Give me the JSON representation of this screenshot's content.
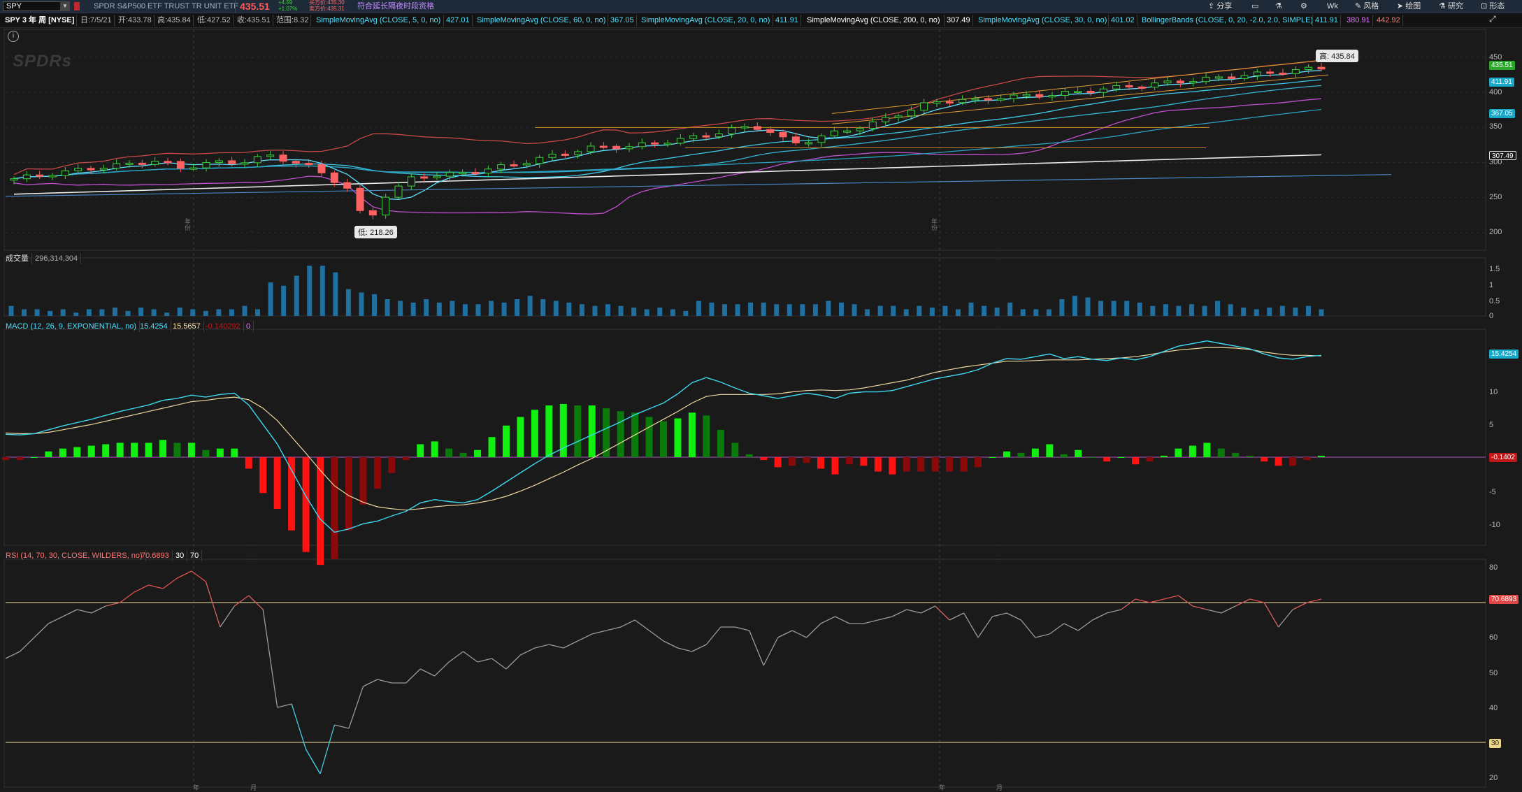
{
  "topbar": {
    "symbol": "SPY",
    "description": "SPDR S&P500 ETF TRUST TR UNIT ETF",
    "last": "435.51",
    "change_abs": "+4.59",
    "change_pct": "+1.07%",
    "bid": "买方价:435.30",
    "ask": "卖方价:435.31",
    "extended_hours": "符合延长隔夜时段资格",
    "buttons": {
      "share": "分享",
      "timeframe": "Wk",
      "style": "风格",
      "draw": "绘图",
      "study": "研究",
      "patterns": "形态"
    }
  },
  "infobar": {
    "title": "SPY 3 年 周 [NYSE]",
    "date": "日:7/5/21",
    "open": "开:433.78",
    "high": "高:435.84",
    "low": "低:427.52",
    "close": "收:435.51",
    "range": "范围:8.32",
    "studies": [
      {
        "label": "SimpleMovingAvg (CLOSE, 5, 0, no)",
        "value": "427.01",
        "color": "#4fe0ff"
      },
      {
        "label": "SimpleMovingAvg (CLOSE, 60, 0, no)",
        "value": "367.05",
        "color": "#4fe0ff"
      },
      {
        "label": "SimpleMovingAvg (CLOSE, 20, 0, no)",
        "value": "411.91",
        "color": "#4fe0ff"
      },
      {
        "label": "SimpleMovingAvg (CLOSE, 200, 0, no)",
        "value": "307.49",
        "color": "#ffffff"
      },
      {
        "label": "SimpleMovingAvg (CLOSE, 30, 0, no)",
        "value": "401.02",
        "color": "#4fe0ff"
      },
      {
        "label": "BollingerBands (CLOSE, 0, 20, -2.0, 2.0, SIMPLE)",
        "value": "411.91",
        "color": "#4fe0ff"
      }
    ],
    "bb_lower": "380.91",
    "bb_upper": "442.92"
  },
  "price_pane": {
    "high_callout": "高: 435.84",
    "low_callout": "低: 218.26",
    "logo": "SPDRs",
    "y_ticks": [
      "450",
      "400",
      "350",
      "300",
      "250",
      "200"
    ],
    "tags": {
      "last": "435.51",
      "sma20": "411.91",
      "sma60": "367.05",
      "sma200": "307.49"
    },
    "year_markers": [
      "年份",
      "年份"
    ]
  },
  "volume_pane": {
    "label": "成交量",
    "value": "296,314,304",
    "y_ticks": [
      "1.5",
      "1",
      "0.5",
      "0"
    ],
    "values": [
      0.3,
      0.2,
      0.2,
      0.15,
      0.2,
      0.1,
      0.2,
      0.2,
      0.25,
      0.15,
      0.25,
      0.2,
      0.1,
      0.25,
      0.2,
      0.15,
      0.2,
      0.2,
      0.3,
      0.2,
      1.0,
      0.9,
      1.2,
      1.5,
      1.5,
      1.3,
      0.8,
      0.7,
      0.65,
      0.5,
      0.45,
      0.4,
      0.5,
      0.4,
      0.45,
      0.35,
      0.35,
      0.45,
      0.4,
      0.5,
      0.6,
      0.5,
      0.45,
      0.4,
      0.35,
      0.3,
      0.35,
      0.3,
      0.25,
      0.2,
      0.25,
      0.2,
      0.15,
      0.45,
      0.4,
      0.35,
      0.35,
      0.4,
      0.4,
      0.35,
      0.35,
      0.35,
      0.35,
      0.45,
      0.4,
      0.35,
      0.2,
      0.3,
      0.3,
      0.2,
      0.3,
      0.25,
      0.3,
      0.2,
      0.4,
      0.3,
      0.25,
      0.4,
      0.2,
      0.2,
      0.2,
      0.5,
      0.6,
      0.55,
      0.45,
      0.45,
      0.45,
      0.4,
      0.3,
      0.35,
      0.3,
      0.35,
      0.3,
      0.45,
      0.35,
      0.25,
      0.2,
      0.25,
      0.3,
      0.25,
      0.3,
      0.2
    ]
  },
  "macd_pane": {
    "label": "MACD (12, 26, 9, EXPONENTIAL, no)",
    "value": "15.4254",
    "avg": "15.5657",
    "diff": "-0.140292",
    "zero": "0",
    "y_ticks": [
      "10",
      "5",
      "0",
      "-5",
      "-10"
    ],
    "tags": {
      "value": "15.4254",
      "diff": "-0.1402"
    },
    "macd": [
      3.5,
      3.4,
      3.6,
      4.2,
      4.8,
      5.3,
      5.8,
      6.4,
      7.0,
      7.5,
      8.0,
      8.7,
      9.0,
      9.5,
      9.2,
      9.6,
      9.8,
      8.0,
      5.0,
      2.0,
      -2.0,
      -6.0,
      -9.5,
      -11.5,
      -11.0,
      -10.2,
      -9.8,
      -9.0,
      -8.3,
      -7.0,
      -6.5,
      -6.8,
      -7.0,
      -6.5,
      -5.2,
      -3.8,
      -2.4,
      -1.0,
      0.3,
      1.4,
      2.4,
      3.4,
      4.4,
      5.4,
      6.5,
      7.4,
      8.3,
      9.7,
      11.4,
      12.2,
      11.5,
      10.6,
      9.8,
      9.4,
      9.0,
      9.4,
      9.8,
      9.5,
      9.0,
      9.8,
      10.0,
      10.0,
      10.2,
      10.8,
      11.4,
      12.0,
      12.4,
      12.8,
      13.4,
      14.4,
      15.1,
      15.0,
      15.4,
      15.8,
      15.1,
      15.4,
      15.0,
      14.8,
      15.2,
      14.9,
      15.4,
      16.2,
      17.0,
      17.4,
      17.8,
      17.4,
      17.0,
      16.6,
      15.8,
      15.2,
      15.0,
      15.4,
      15.6
    ],
    "signal": [
      3.7,
      3.6,
      3.6,
      3.8,
      4.2,
      4.6,
      5.0,
      5.5,
      6.0,
      6.5,
      7.0,
      7.5,
      8.0,
      8.5,
      8.7,
      9.0,
      9.2,
      8.8,
      7.5,
      5.6,
      3.1,
      0.6,
      -2.0,
      -4.4,
      -5.9,
      -6.9,
      -7.6,
      -7.9,
      -8.1,
      -7.9,
      -7.6,
      -7.4,
      -7.3,
      -7.0,
      -6.6,
      -6.0,
      -5.2,
      -4.3,
      -3.3,
      -2.3,
      -1.2,
      -0.2,
      1.0,
      2.2,
      3.4,
      4.6,
      5.8,
      7.0,
      8.3,
      9.3,
      9.6,
      9.6,
      9.6,
      9.6,
      9.7,
      10.0,
      10.2,
      10.3,
      10.2,
      10.3,
      10.6,
      11.0,
      11.4,
      11.8,
      12.4,
      13.0,
      13.4,
      13.8,
      14.1,
      14.4,
      14.7,
      14.7,
      14.8,
      14.9,
      14.9,
      14.9,
      15.0,
      15.1,
      15.2,
      15.4,
      15.7,
      16.1,
      16.4,
      16.6,
      16.8,
      16.8,
      16.7,
      16.5,
      16.1,
      15.8,
      15.6,
      15.6,
      15.5
    ]
  },
  "rsi_pane": {
    "label": "RSI (14, 70, 30, CLOSE, WILDERS, no)",
    "value": "70.6893",
    "ob": "30",
    "os": "70",
    "y_ticks": [
      "80",
      "70",
      "60",
      "50",
      "40",
      "30",
      "20"
    ],
    "tags": {
      "value": "70.6893",
      "level30": "30"
    },
    "values": [
      54,
      56,
      60,
      64,
      66,
      68,
      67,
      69,
      70,
      73,
      75,
      74,
      77,
      79,
      76,
      63,
      69,
      72,
      68,
      40,
      41,
      28,
      21,
      35,
      34,
      46,
      48,
      47,
      47,
      51,
      49,
      53,
      56,
      53,
      54,
      51,
      55,
      57,
      58,
      57,
      59,
      61,
      62,
      63,
      65,
      62,
      59,
      57,
      56,
      58,
      63,
      63,
      62,
      52,
      60,
      62,
      60,
      64,
      66,
      64,
      64,
      65,
      66,
      68,
      67,
      69,
      65,
      67,
      60,
      66,
      67,
      65,
      60,
      61,
      64,
      62,
      65,
      67,
      68,
      71,
      70,
      71,
      72,
      69,
      68,
      67,
      69,
      71,
      70,
      63,
      68,
      70,
      71
    ]
  },
  "x_labels": [
    "年",
    "月",
    "年",
    "月"
  ]
}
